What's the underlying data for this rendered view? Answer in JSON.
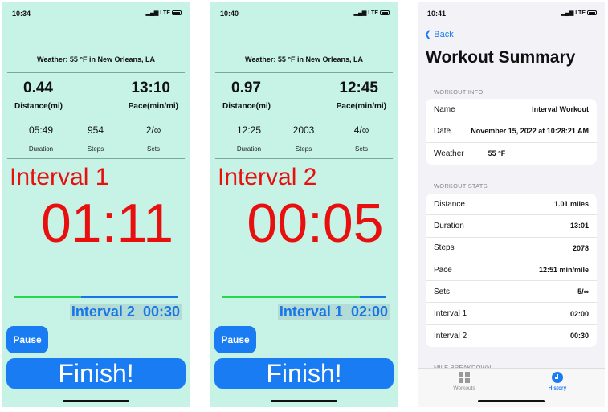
{
  "screens": [
    {
      "status_time": "10:34",
      "carrier": "LTE",
      "weather": "Weather: 55 °F in New Orleans, LA",
      "distance": "0.44",
      "distance_label": "Distance(mi)",
      "pace": "13:10",
      "pace_label": "Pace(min/mi)",
      "duration": "05:49",
      "duration_label": "Duration",
      "steps": "954",
      "steps_label": "Steps",
      "sets": "2/∞",
      "sets_label": "Sets",
      "interval_name": "Interval 1",
      "clock": "01:11",
      "progress_pct": 41,
      "next_interval": "Interval 2  00:30",
      "pause_label": "Pause",
      "finish_label": "Finish!"
    },
    {
      "status_time": "10:40",
      "carrier": "LTE",
      "weather": "Weather: 55 °F in New Orleans, LA",
      "distance": "0.97",
      "distance_label": "Distance(mi)",
      "pace": "12:45",
      "pace_label": "Pace(min/mi)",
      "duration": "12:25",
      "duration_label": "Duration",
      "steps": "2003",
      "steps_label": "Steps",
      "sets": "4/∞",
      "sets_label": "Sets",
      "interval_name": "Interval 2",
      "clock": "00:05",
      "progress_pct": 84,
      "next_interval": "Interval 1  02:00",
      "pause_label": "Pause",
      "finish_label": "Finish!"
    }
  ],
  "summary": {
    "status_time": "10:41",
    "carrier": "LTE",
    "back_label": "Back",
    "title": "Workout Summary",
    "info_header": "WORKOUT INFO",
    "info": [
      {
        "k": "Name",
        "v": "Interval Workout"
      },
      {
        "k": "Date",
        "v": "November 15, 2022 at 10:28:21 AM"
      },
      {
        "k": "Weather",
        "v": "55 °F"
      }
    ],
    "stats_header": "WORKOUT STATS",
    "stats": [
      {
        "k": "Distance",
        "v": "1.01 miles"
      },
      {
        "k": "Duration",
        "v": "13:01"
      },
      {
        "k": "Steps",
        "v": "2078"
      },
      {
        "k": "Pace",
        "v": "12:51 min/mile"
      },
      {
        "k": "Sets",
        "v": "5/∞"
      },
      {
        "k": "Interval 1",
        "v": "02:00"
      },
      {
        "k": "Interval 2",
        "v": "00:30"
      }
    ],
    "breakdown_header": "MILE BREAKDOWN",
    "tabs": [
      {
        "label": "Workouts",
        "icon": "grid-icon",
        "active": false
      },
      {
        "label": "History",
        "icon": "clock-icon",
        "active": true
      }
    ],
    "accent": "#1a7cf2"
  },
  "colors": {
    "timer_bg": "#c6f3e6",
    "timer_red": "#e8100f",
    "progress_green": "#28d84a",
    "button_blue": "#1a7cf2"
  }
}
